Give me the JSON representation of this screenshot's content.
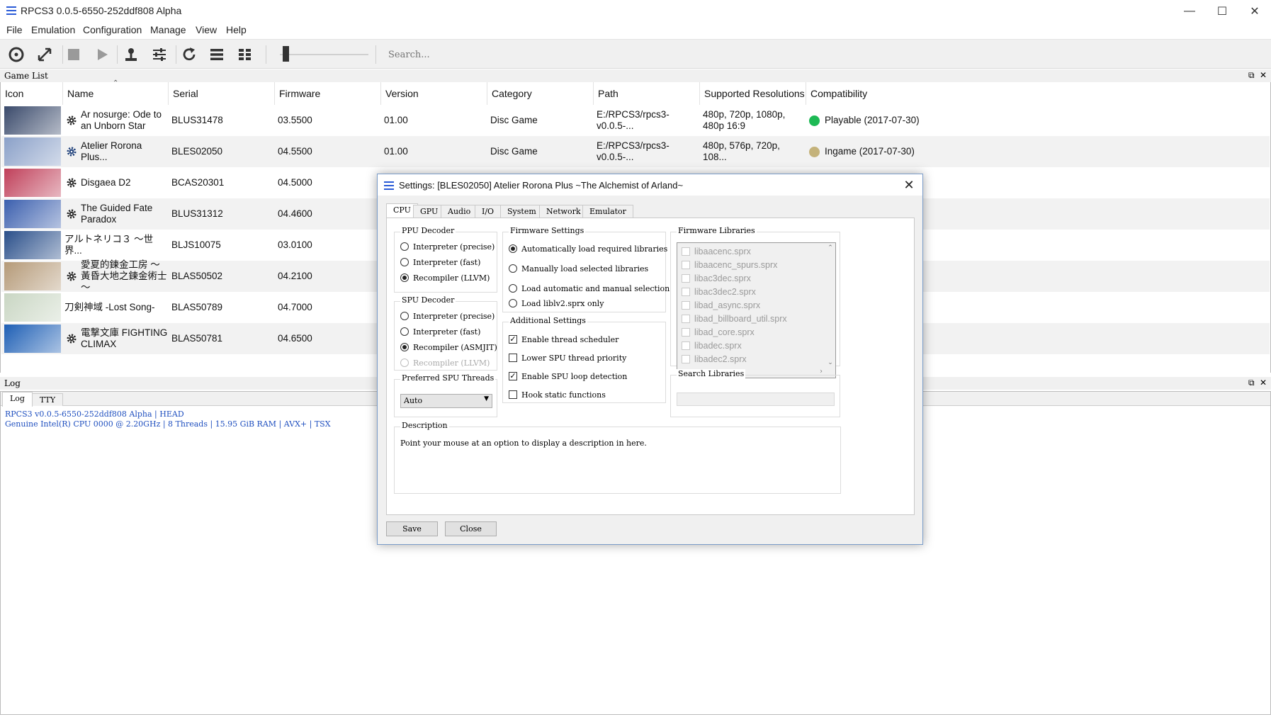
{
  "window": {
    "title": "RPCS3 0.0.5-6550-252ddf808 Alpha"
  },
  "menu": [
    "File",
    "Emulation",
    "Configuration",
    "Manage",
    "View",
    "Help"
  ],
  "search": {
    "placeholder": "Search..."
  },
  "gamelist": {
    "title": "Game List",
    "columns": [
      "Icon",
      "Name",
      "Serial",
      "Firmware",
      "Version",
      "Category",
      "Path",
      "Supported Resolutions",
      "Compatibility"
    ],
    "rows": [
      {
        "name": "Ar nosurge: Ode to an Unborn Star",
        "serial": "BLUS31478",
        "firmware": "03.5500",
        "version": "01.00",
        "category": "Disc Game",
        "path": "E:/RPCS3/rpcs3-v0.0.5-...",
        "resolutions": "480p, 720p, 1080p, 480p 16:9",
        "compat": "Playable (2017-07-30)",
        "compat_color": "#1db954",
        "icon_color": "#3a4a6b"
      },
      {
        "name": "Atelier Rorona Plus...",
        "serial": "BLES02050",
        "firmware": "04.5500",
        "version": "01.00",
        "category": "Disc Game",
        "path": "E:/RPCS3/rpcs3-v0.0.5-...",
        "resolutions": "480p, 576p, 720p, 108...",
        "compat": "Ingame (2017-07-30)",
        "compat_color": "#c4b27a",
        "icon_color": "#8aa0c8"
      },
      {
        "name": "Disgaea D2",
        "serial": "BCAS20301",
        "firmware": "04.5000",
        "version": "",
        "category": "",
        "path": "",
        "resolutions": "",
        "compat": "",
        "compat_color": "",
        "icon_color": "#c0405a"
      },
      {
        "name": "The Guided Fate Paradox",
        "serial": "BLUS31312",
        "firmware": "04.4600",
        "version": "",
        "category": "",
        "path": "",
        "resolutions": "",
        "compat": "",
        "compat_color": "",
        "icon_color": "#3b5fae"
      },
      {
        "name": "アルトネリコ３ ～世界...",
        "serial": "BLJS10075",
        "firmware": "03.0100",
        "version": "",
        "category": "",
        "path": "",
        "resolutions": "",
        "compat": "",
        "compat_color": "",
        "icon_color": "#2a4f8a"
      },
      {
        "name": "愛夏的鍊金工房 ～黃昏大地之鍊金術士～",
        "serial": "BLAS50502",
        "firmware": "04.2100",
        "version": "",
        "category": "",
        "path": "",
        "resolutions": "",
        "compat": "",
        "compat_color": "",
        "icon_color": "#b59a78"
      },
      {
        "name": "刀剣神域 -Lost Song-",
        "serial": "BLAS50789",
        "firmware": "04.7000",
        "version": "",
        "category": "",
        "path": "",
        "resolutions": "",
        "compat": "",
        "compat_color": "",
        "icon_color": "#c9d6c3"
      },
      {
        "name": "電撃文庫 FIGHTING CLIMAX",
        "serial": "BLAS50781",
        "firmware": "04.6500",
        "version": "",
        "category": "",
        "path": "",
        "resolutions": "",
        "compat": "",
        "compat_color": "",
        "icon_color": "#1e5fb5"
      }
    ]
  },
  "log": {
    "title": "Log",
    "tabs": [
      "Log",
      "TTY"
    ],
    "lines": [
      "RPCS3 v0.0.5-6550-252ddf808 Alpha | HEAD",
      "Genuine Intel(R) CPU 0000 @ 2.20GHz | 8 Threads | 15.95 GiB RAM | AVX+ | TSX"
    ]
  },
  "dialog": {
    "title": "Settings: [BLES02050] Atelier Rorona Plus ~The Alchemist of Arland~",
    "tabs": [
      "CPU",
      "GPU",
      "Audio",
      "I/O",
      "System",
      "Network",
      "Emulator"
    ],
    "ppu": {
      "title": "PPU Decoder",
      "options": [
        "Interpreter (precise)",
        "Interpreter (fast)",
        "Recompiler (LLVM)"
      ],
      "selected": 2
    },
    "spu": {
      "title": "SPU Decoder",
      "options": [
        "Interpreter (precise)",
        "Interpreter (fast)",
        "Recompiler (ASMJIT)",
        "Recompiler (LLVM)"
      ],
      "selected": 2
    },
    "spu_threads": {
      "title": "Preferred SPU Threads",
      "value": "Auto"
    },
    "firmware_settings": {
      "title": "Firmware Settings",
      "options": [
        "Automatically load required libraries",
        "Manually load selected libraries",
        "Load automatic and manual selection",
        "Load liblv2.sprx only"
      ],
      "selected": 0
    },
    "additional": {
      "title": "Additional Settings",
      "options": [
        "Enable thread scheduler",
        "Lower SPU thread priority",
        "Enable SPU loop detection",
        "Hook static functions"
      ],
      "checked": [
        true,
        false,
        true,
        false
      ]
    },
    "firmware_libraries": {
      "title": "Firmware Libraries",
      "items": [
        "libaacenc.sprx",
        "libaacenc_spurs.sprx",
        "libac3dec.sprx",
        "libac3dec2.sprx",
        "libad_async.sprx",
        "libad_billboard_util.sprx",
        "libad_core.sprx",
        "libadec.sprx",
        "libadec2.sprx"
      ]
    },
    "search_libraries": {
      "title": "Search Libraries"
    },
    "description": {
      "title": "Description",
      "text": "Point your mouse at an option to display a description in here."
    },
    "buttons": {
      "save": "Save",
      "close": "Close"
    }
  }
}
